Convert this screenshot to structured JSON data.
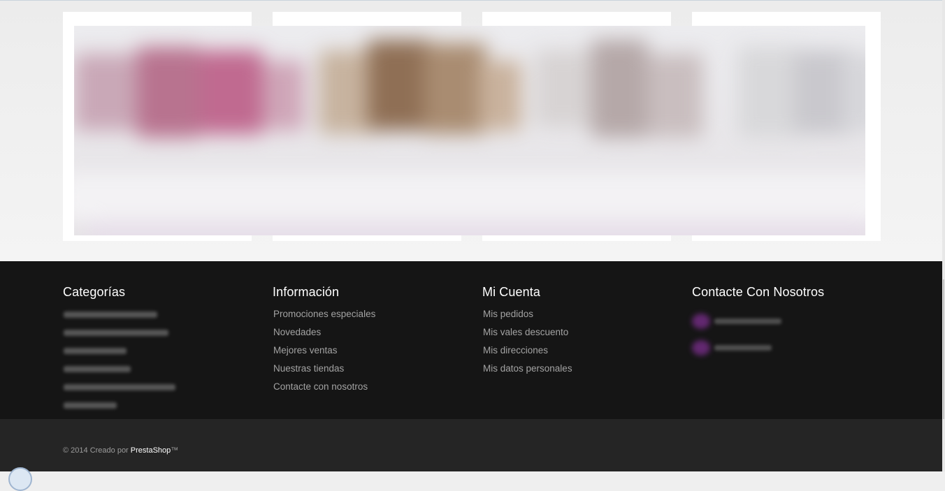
{
  "footer": {
    "categories": {
      "title": "Categorías",
      "items": [
        "",
        "",
        "",
        "",
        "",
        ""
      ]
    },
    "informacion": {
      "title": "Información",
      "items": [
        "Promociones especiales",
        "Novedades",
        "Mejores ventas",
        "Nuestras tiendas",
        "Contacte con nosotros"
      ]
    },
    "mi_cuenta": {
      "title": "Mi Cuenta",
      "items": [
        "Mis pedidos",
        "Mis vales descuento",
        "Mis direcciones",
        "Mis datos personales"
      ]
    },
    "contacto": {
      "title": "Contacte Con Nosotros"
    }
  },
  "bottom": {
    "copyright_prefix": "© 2014 Creado por ",
    "brand": "PrestaShop",
    "trademark": "™"
  },
  "colors": {
    "footer_bg": "#151515",
    "bottom_bar_bg": "#252525",
    "accent_purple": "#6b2a7a"
  },
  "icons": {
    "contact_1": "location-icon",
    "contact_2": "phone-icon"
  }
}
